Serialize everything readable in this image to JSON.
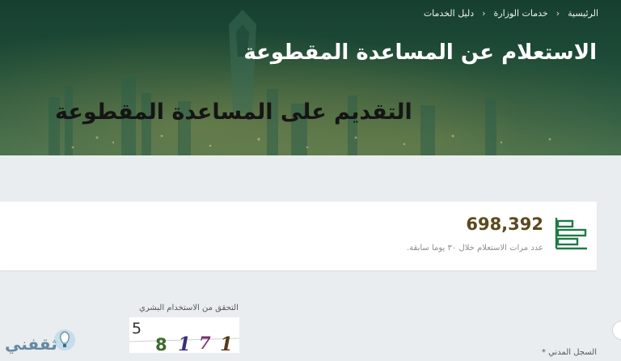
{
  "breadcrumb": {
    "items": [
      "الرئيسية",
      "خدمات الوزارة",
      "دليل الخدمات"
    ]
  },
  "header": {
    "title": "الاستعلام عن المساعدة المقطوعة"
  },
  "overlay": {
    "title": "التقديم على المساعدة المقطوعة"
  },
  "stats": {
    "count": "698,392",
    "caption": "عدد مرات الاستعلام خلال ٣٠ يوما سابقة.",
    "icon": "bar-chart-icon"
  },
  "captcha": {
    "label": "التحقق من الاستخدام البشري",
    "code": "58171"
  },
  "form": {
    "civil_record_label": "السجل المدني *"
  },
  "watermark": {
    "text": "ثقفني"
  },
  "colors": {
    "hero_green": "#1e4d39",
    "accent_green": "#1f7a45",
    "number_brown": "#5c4a1e"
  }
}
